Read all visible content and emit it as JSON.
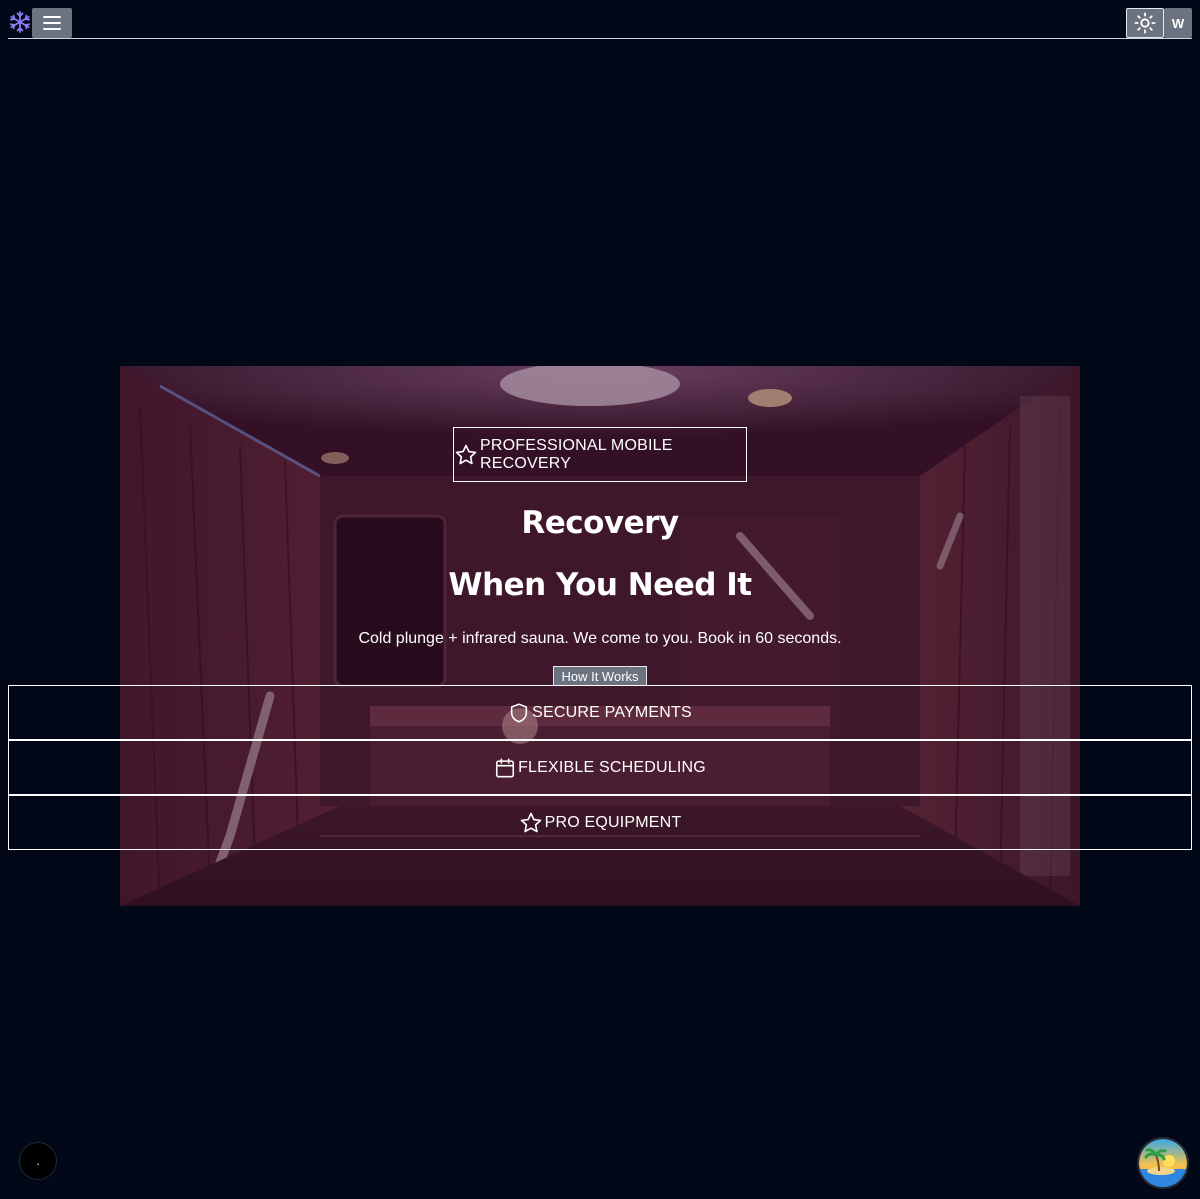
{
  "header": {
    "logo_icon": "snowflake-icon",
    "menu_icon": "hamburger-menu-icon",
    "theme_icon": "sun-icon",
    "user_initial": "W"
  },
  "hero": {
    "badge_icon": "star-icon",
    "badge_label": "PROFESSIONAL MOBILE RECOVERY",
    "headline_line1": "Recovery",
    "headline_line2": "When You Need It",
    "subtitle": "Cold plunge + infrared sauna. We come to you. Book in 60 seconds.",
    "cta_label": "How It Works"
  },
  "features": [
    {
      "icon": "shield-icon",
      "label": "SECURE PAYMENTS"
    },
    {
      "icon": "calendar-icon",
      "label": "FLEXIBLE SCHEDULING"
    },
    {
      "icon": "star-icon",
      "label": "PRO EQUIPMENT"
    }
  ],
  "floating": {
    "left_button_text": ".",
    "right_button_icon": "tropical-island-icon"
  },
  "colors": {
    "page_background": "#020817",
    "button_gray": "#6b7280",
    "text": "#ffffff",
    "logo_accent": "#8b7cf6"
  }
}
